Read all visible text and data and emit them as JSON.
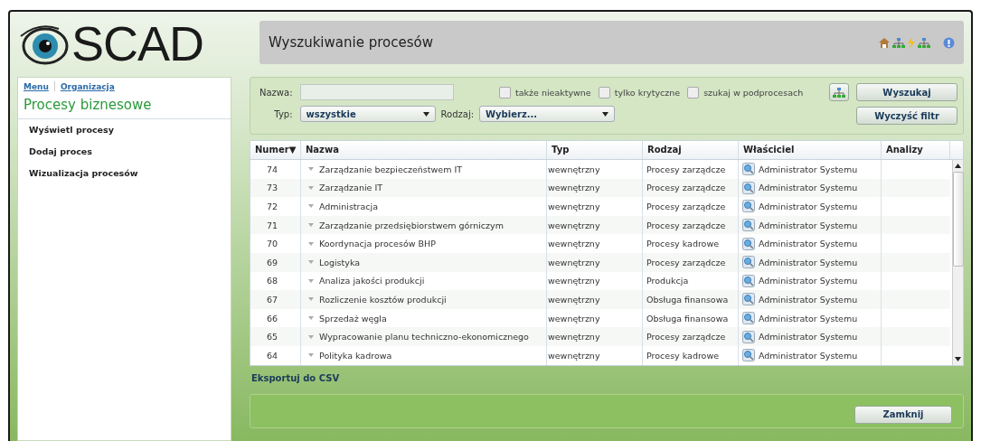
{
  "logo": {
    "text": "SCAD"
  },
  "header": {
    "title": "Wyszukiwanie procesów"
  },
  "sidebar": {
    "links": [
      "Menu",
      "Organizacja"
    ],
    "title": "Procesy biznesowe",
    "items": [
      "Wyświetl procesy",
      "Dodaj proces",
      "Wizualizacja procesów"
    ]
  },
  "filters": {
    "name_label": "Nazwa:",
    "type_label": "Typ:",
    "type_value": "wszystkie",
    "kind_label": "Rodzaj:",
    "kind_value": "Wybierz...",
    "checkboxes": [
      {
        "label": "także nieaktywne",
        "checked": false
      },
      {
        "label": "tylko krytyczne",
        "checked": false
      },
      {
        "label": "szukaj w podprocesach",
        "checked": false
      }
    ],
    "buttons": [
      "Wyszukaj",
      "Wyczyść filtr"
    ]
  },
  "table": {
    "columns": [
      {
        "label": "Numer",
        "sort": "▼"
      },
      {
        "label": "Nazwa"
      },
      {
        "label": "Typ"
      },
      {
        "label": "Rodzaj"
      },
      {
        "label": "Właściciel"
      },
      {
        "label": "Analizy"
      }
    ],
    "rows": [
      {
        "number": "74",
        "name": "Zarządzanie bezpieczeństwem IT",
        "type": "wewnętrzny",
        "kind": "Procesy zarządcze",
        "owner": "Administrator Systemu"
      },
      {
        "number": "73",
        "name": "Zarządzanie IT",
        "type": "wewnętrzny",
        "kind": "Procesy zarządcze",
        "owner": "Administrator Systemu"
      },
      {
        "number": "72",
        "name": "Administracja",
        "type": "wewnętrzny",
        "kind": "Procesy zarządcze",
        "owner": "Administrator Systemu"
      },
      {
        "number": "71",
        "name": "Zarządzanie przedsiębiorstwem górniczym",
        "type": "wewnętrzny",
        "kind": "Procesy zarządcze",
        "owner": "Administrator Systemu"
      },
      {
        "number": "70",
        "name": "Koordynacja procesów BHP",
        "type": "wewnętrzny",
        "kind": "Procesy kadrowe",
        "owner": "Administrator Systemu"
      },
      {
        "number": "69",
        "name": "Logistyka",
        "type": "wewnętrzny",
        "kind": "Procesy zarządcze",
        "owner": "Administrator Systemu"
      },
      {
        "number": "68",
        "name": "Analiza jakości produkcji",
        "type": "wewnętrzny",
        "kind": "Produkcja",
        "owner": "Administrator Systemu"
      },
      {
        "number": "67",
        "name": "Rozliczenie kosztów produkcji",
        "type": "wewnętrzny",
        "kind": "Obsługa finansowa",
        "owner": "Administrator Systemu"
      },
      {
        "number": "66",
        "name": "Sprzedaż węgla",
        "type": "wewnętrzny",
        "kind": "Obsługa finansowa",
        "owner": "Administrator Systemu"
      },
      {
        "number": "65",
        "name": "Wypracowanie planu techniczno-ekonomicznego",
        "type": "wewnętrzny",
        "kind": "Procesy zarządcze",
        "owner": "Administrator Systemu"
      },
      {
        "number": "64",
        "name": "Polityka kadrowa",
        "type": "wewnętrzny",
        "kind": "Procesy kadrowe",
        "owner": "Administrator Systemu"
      }
    ]
  },
  "export_link": "Eksportuj do CSV",
  "footer": {
    "button": "Zamknij"
  }
}
